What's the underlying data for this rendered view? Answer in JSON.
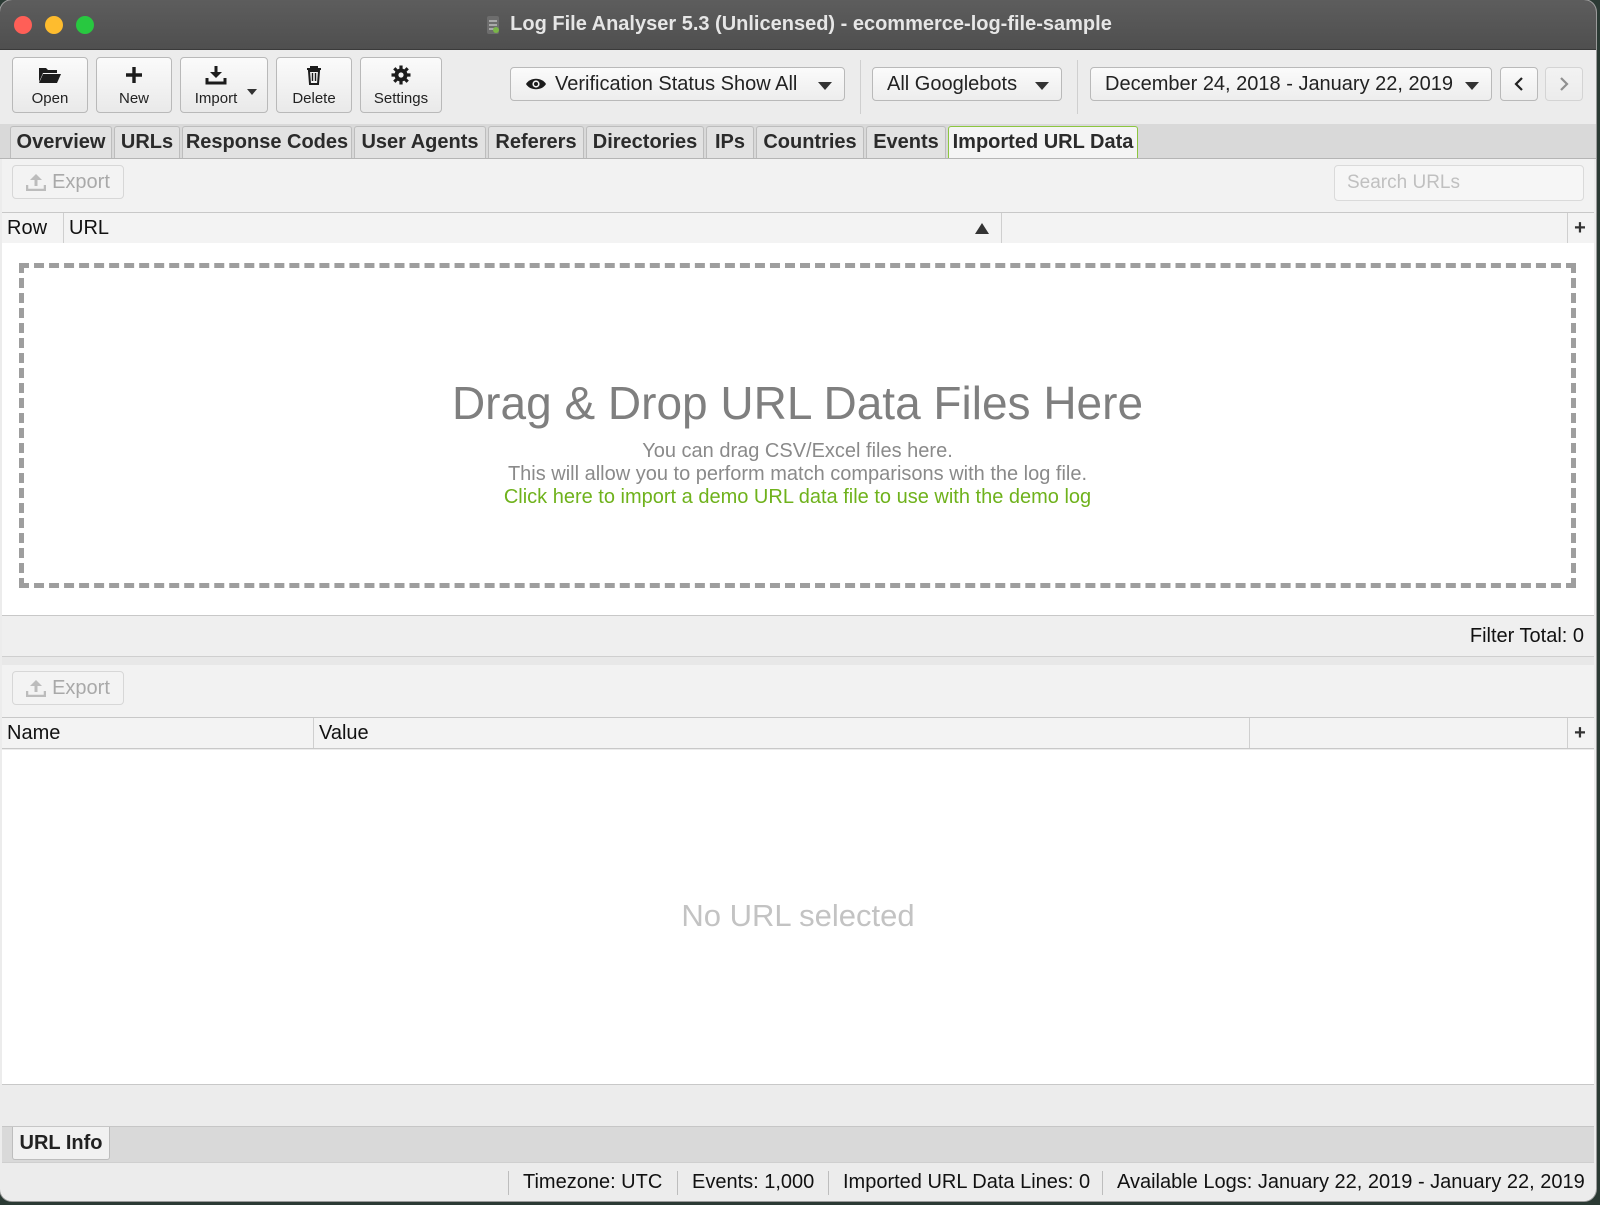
{
  "window": {
    "title": "Log File Analyser 5.3 (Unlicensed) - ecommerce-log-file-sample"
  },
  "toolbar": {
    "open_label": "Open",
    "new_label": "New",
    "import_label": "Import",
    "delete_label": "Delete",
    "settings_label": "Settings",
    "verification_select": "Verification Status Show All",
    "bot_select": "All Googlebots",
    "date_range": "December 24, 2018 - January 22, 2019"
  },
  "tabs": [
    {
      "label": "Overview",
      "active": false
    },
    {
      "label": "URLs",
      "active": false
    },
    {
      "label": "Response Codes",
      "active": false
    },
    {
      "label": "User Agents",
      "active": false
    },
    {
      "label": "Referers",
      "active": false
    },
    {
      "label": "Directories",
      "active": false
    },
    {
      "label": "IPs",
      "active": false
    },
    {
      "label": "Countries",
      "active": false
    },
    {
      "label": "Events",
      "active": false
    },
    {
      "label": "Imported URL Data",
      "active": true
    }
  ],
  "top_panel": {
    "export_label": "Export",
    "search_placeholder": "Search URLs",
    "columns": [
      "Row",
      "URL"
    ],
    "drop_title": "Drag & Drop URL Data Files Here",
    "drop_line1": "You can drag CSV/Excel files here.",
    "drop_line2": "This will allow you to perform match comparisons with the log file.",
    "drop_link": "Click here to import a demo URL data file to use with the demo log",
    "filter_total": "Filter Total: 0"
  },
  "bottom_panel": {
    "export_label": "Export",
    "columns": [
      "Name",
      "Value"
    ],
    "empty_message": "No URL selected",
    "tab_label": "URL Info"
  },
  "status": {
    "timezone": "Timezone:  UTC",
    "events": "Events:  1,000",
    "imported_lines": "Imported URL Data Lines:  0",
    "available_logs": "Available Logs:  January 22, 2019 - January 22, 2019"
  },
  "colors": {
    "accent_green": "#6fb21c",
    "active_tab_border": "#8cc63f"
  }
}
